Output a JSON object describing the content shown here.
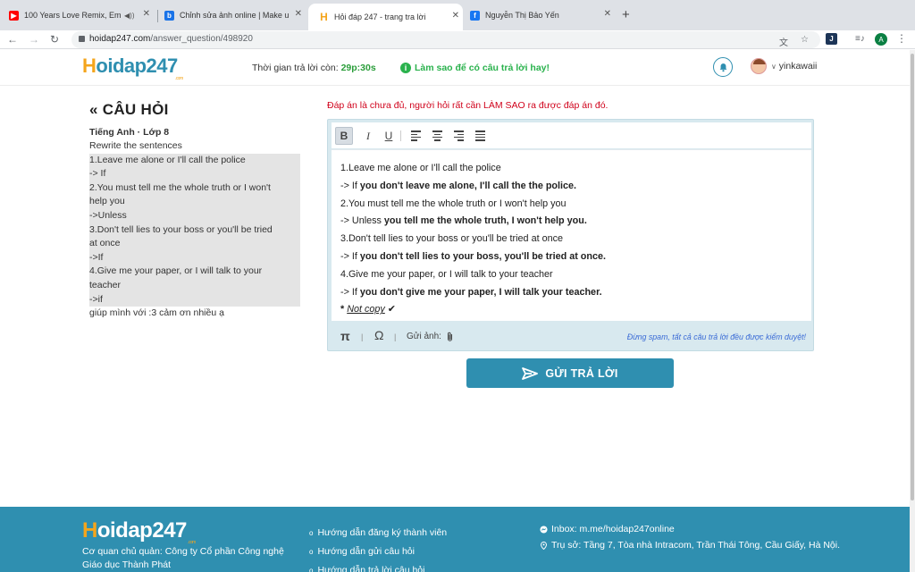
{
  "browser": {
    "tabs": [
      {
        "title": "100 Years Love Remix, Em",
        "favicon": "youtube-icon",
        "color": "#ff0000"
      },
      {
        "title": "Chỉnh sửa ảnh online | Make u",
        "favicon": "photo-editor-icon",
        "color": "#1a73e8"
      },
      {
        "title": "Hỏi đáp 247 - trang tra lời",
        "favicon": "hoidap-icon",
        "color": "#f4a51c",
        "active": true
      },
      {
        "title": "Nguyễn Thị Bảo Yến",
        "favicon": "facebook-icon",
        "color": "#1877f2"
      }
    ],
    "url_host": "hoidap247.com",
    "url_path": "/answer_question/498920",
    "profile_initial": "A"
  },
  "header": {
    "logo_h": "H",
    "logo_rest": "oidap247",
    "logo_suffix": ".com",
    "timer_label": "Thời gian trả lời còn:",
    "timer_value": "29p:30s",
    "help_text": "Làm sao để có câu trả lời hay!",
    "username": "yinkawaii"
  },
  "question": {
    "heading": "CÂU HỎI",
    "meta": "Tiếng Anh · Lớp 8",
    "lines": [
      {
        "text": "Rewrite the sentences",
        "hl": false
      },
      {
        "text": "1.Leave me alone or I'll call the police",
        "hl": true
      },
      {
        "text": "-> If",
        "hl": true
      },
      {
        "text": "2.You must tell me the whole truth or I won't",
        "hl": true,
        "just": true
      },
      {
        "text": "help you",
        "hl": true
      },
      {
        "text": "->Unless",
        "hl": true
      },
      {
        "text": "3.Don't tell lies to your boss or you'll be tried",
        "hl": true,
        "just": true
      },
      {
        "text": "at once",
        "hl": true
      },
      {
        "text": "->If",
        "hl": true
      },
      {
        "text": "4.Give me your paper, or I will talk to your",
        "hl": true,
        "just": true
      },
      {
        "text": "teacher",
        "hl": true
      },
      {
        "text": "->if",
        "hl": true
      },
      {
        "text": "giúp mình với :3 cảm ơn nhiều ạ",
        "hl": false
      }
    ]
  },
  "answer": {
    "warning": "Đáp án là chưa đủ, người hỏi rất cần LÀM SAO ra được đáp án đó.",
    "toolbar": {
      "bold": "B",
      "italic": "I",
      "underline": "U"
    },
    "content": {
      "q1": "1.Leave me alone or I'll call the police",
      "a1_prefix": "-> If ",
      "a1_bold": "you don't leave me alone, I'll call the the police.",
      "q2": "2.You must tell me the whole truth or I won't help you",
      "a2_prefix": "-> Unless ",
      "a2_bold": "you tell me the whole truth, I won't help you.",
      "q3": "3.Don't tell lies to your boss or you'll be tried at once",
      "a3_prefix": "-> If ",
      "a3_bold": "you don't tell lies to your boss, you'll be tried at once.",
      "q4": "4.Give me your paper, or I will talk to your teacher",
      "a4_prefix": "-> If ",
      "a4_bold": "you don't give me your paper, I will talk your teacher.",
      "note_star": "* ",
      "note_text": "Not copy",
      "note_check": " ✔"
    },
    "bottom": {
      "pi": "π",
      "omega": "Ω",
      "send_image": "Gửi ảnh:",
      "spam_note": "Đừng spam, tất cả câu trả lời đều được kiểm duyệt!"
    },
    "submit_label": "GỬI TRẢ LỜI"
  },
  "footer": {
    "logo_h": "H",
    "logo_rest": "oidap247",
    "logo_suffix": ".com",
    "org_line1": "Cơ quan chủ quản: Công ty Cổ phần Công nghệ",
    "org_line2": "Giáo dục Thành Phát",
    "links": [
      "Hướng dẫn đăng ký thành viên",
      "Hướng dẫn gửi câu hỏi",
      "Hướng dẫn trả lời câu hỏi"
    ],
    "inbox": "Inbox: m.me/hoidap247online",
    "address": "Trụ sở: Tầng 7, Tòa nhà Intracom, Trần Thái Tông, Cầu Giấy, Hà Nội."
  }
}
